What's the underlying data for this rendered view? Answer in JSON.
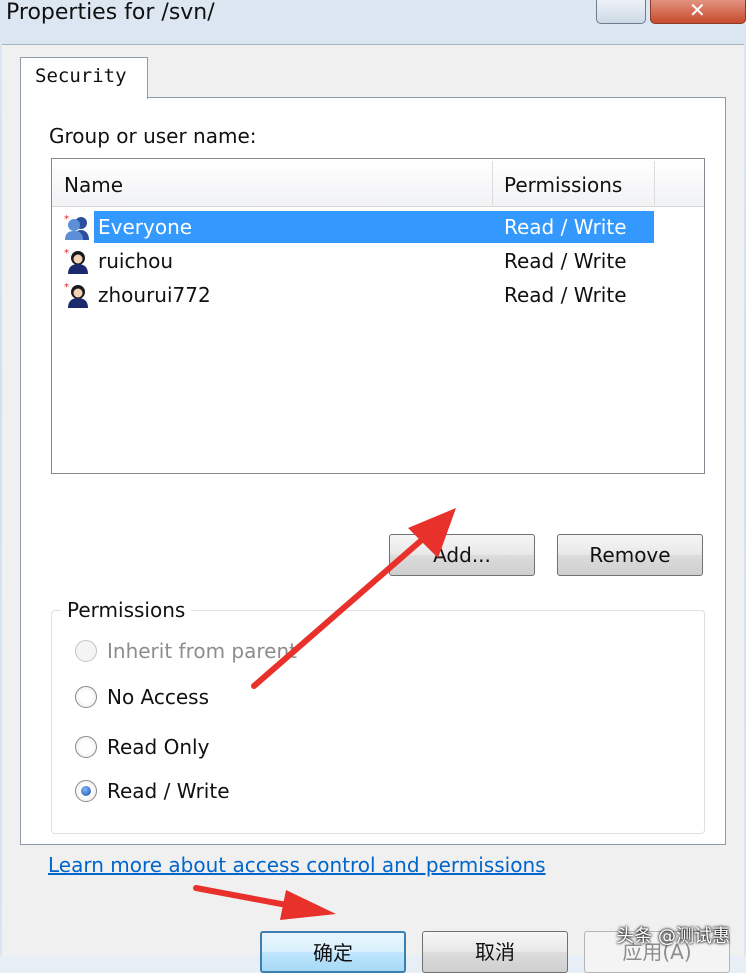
{
  "window": {
    "title": "Properties for /svn/",
    "close_glyph": "✕",
    "minimize_icon": "minimize-icon"
  },
  "tabs": [
    {
      "label": "Security",
      "active": true
    }
  ],
  "security": {
    "group_label": "Group or user name:",
    "columns": {
      "name": "Name",
      "permissions": "Permissions"
    },
    "users": [
      {
        "name": "Everyone",
        "permission": "Read / Write",
        "selected": true,
        "icon": "group-icon"
      },
      {
        "name": "ruichou",
        "permission": "Read / Write",
        "selected": false,
        "icon": "user-icon"
      },
      {
        "name": "zhourui772",
        "permission": "Read / Write",
        "selected": false,
        "icon": "user-icon"
      }
    ],
    "add_label": "Add...",
    "remove_label": "Remove"
  },
  "permissions": {
    "title": "Permissions",
    "options": [
      {
        "label": "Inherit from parent",
        "checked": false,
        "disabled": true
      },
      {
        "label": "No Access",
        "checked": false,
        "disabled": false
      },
      {
        "label": "Read Only",
        "checked": false,
        "disabled": false
      },
      {
        "label": "Read / Write",
        "checked": true,
        "disabled": false
      }
    ]
  },
  "link": {
    "text": "Learn more about access control and permissions"
  },
  "footer": {
    "ok_label": "确定",
    "cancel_label": "取消",
    "apply_label": "应用(A)"
  },
  "watermark": "头条 @测试惠",
  "colors": {
    "selection": "#3399ff",
    "link": "#0066cc",
    "arrow": "#e8312a"
  }
}
